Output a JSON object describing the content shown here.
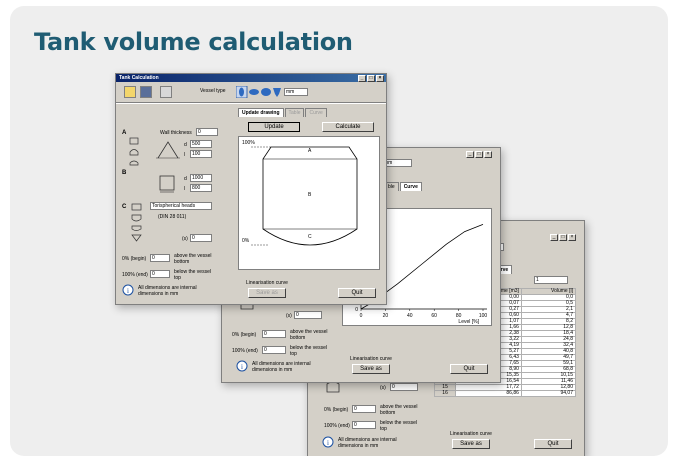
{
  "page_title": "Tank volume calculation",
  "colors": {
    "title": "#1f5c73",
    "card_bg": "#eeeeee",
    "titlebar": "#0a246a"
  },
  "win1": {
    "title": "Tank Calculation",
    "vessel_type_label": "Vessel type",
    "unit_select": "mm",
    "wall_thickness_label": "Wall thickness",
    "wall_thickness_value": "0",
    "section_a": "A",
    "section_b": "B",
    "section_c": "C",
    "a_d_label": "d",
    "a_d_value": "500",
    "a_l_label": "l",
    "a_l_value": "100",
    "b_d_label": "d",
    "b_d_value": "1000",
    "b_l_label": "l",
    "b_l_value": "800",
    "head_type": "Torispherical heads",
    "din_label": "(DIN 28 011)",
    "h_label": "(s)",
    "h_value": "0",
    "begin_label": "0% (begin)",
    "begin_value": "0",
    "begin_desc": "above the vessel bottom",
    "end_label": "100% (end)",
    "end_value": "0",
    "end_desc": "below the vessel top",
    "info_text": "All dimensions are internal dimensions in mm",
    "tabs": [
      "Update drawing",
      "Table",
      "Curve"
    ],
    "update_button": "Update",
    "calculate_button": "Calculate",
    "drawing_top_label": "100%",
    "drawing_bottom_label": "0%",
    "drawing_a": "A",
    "drawing_b": "B",
    "drawing_c": "C",
    "linearisation_label": "Linearisation curve",
    "save_button": "Save as",
    "quit_button": "Quit"
  },
  "win2": {
    "unit_select": "mm",
    "tabs": [
      "ble",
      "Curve"
    ],
    "h_label": "(s)",
    "h_value": "0",
    "begin_label": "0% (begin)",
    "begin_value": "0",
    "begin_desc": "above the vessel bottom",
    "end_label": "100% (end)",
    "end_value": "0",
    "end_desc": "below the vessel top",
    "info_text": "All dimensions are internal dimensions in mm",
    "linearisation_label": "Linearisation curve",
    "save_button": "Save as",
    "quit_button": "Quit",
    "x_axis_label": "Level [%]",
    "x_ticks": [
      "0",
      "20",
      "40",
      "60",
      "80",
      "100"
    ],
    "y_ticks": [
      "0",
      "50"
    ]
  },
  "win3": {
    "tab": "Curve",
    "select_value": "1",
    "col_headers": [
      "Volume [m3]",
      "Volume [l]"
    ],
    "rows": [
      {
        "idx": "",
        "v": "0,00",
        "l": "0,0"
      },
      {
        "idx": "",
        "v": "0,07",
        "l": "0,5"
      },
      {
        "idx": "",
        "v": "0,27",
        "l": "2,1"
      },
      {
        "idx": "",
        "v": "0,60",
        "l": "4,7"
      },
      {
        "idx": "",
        "v": "1,07",
        "l": "8,2"
      },
      {
        "idx": "",
        "v": "1,66",
        "l": "12,8"
      },
      {
        "idx": "",
        "v": "2,38",
        "l": "18,4"
      },
      {
        "idx": "",
        "v": "3,22",
        "l": "24,8"
      },
      {
        "idx": "",
        "v": "4,19",
        "l": "32,4"
      },
      {
        "idx": "",
        "v": "5,27",
        "l": "40,8"
      },
      {
        "idx": "",
        "v": "6,43",
        "l": "49,7"
      },
      {
        "idx": "",
        "v": "7,65",
        "l": "59,1"
      },
      {
        "idx": "",
        "v": "8,90",
        "l": "68,8"
      },
      {
        "idx": "13",
        "v": "15,35",
        "l": "10,15"
      },
      {
        "idx": "14",
        "v": "16,54",
        "l": "11,46"
      },
      {
        "idx": "15",
        "v": "17,72",
        "l": "12,80"
      },
      {
        "idx": "16",
        "v": "86,86",
        "l": "94,07"
      }
    ],
    "h_label": "(s)",
    "h_value": "0",
    "begin_label": "0% (begin)",
    "begin_value": "0",
    "begin_desc": "above the vessel bottom",
    "end_label": "100% (end)",
    "end_value": "0",
    "end_desc": "below the vessel top",
    "info_text": "All dimensions are internal dimensions in mm",
    "linearisation_label": "Linearisation curve",
    "save_button": "Save as",
    "quit_button": "Quit"
  },
  "chart_data": {
    "type": "line",
    "title": "",
    "xlabel": "Level [%]",
    "ylabel": "",
    "xlim": [
      0,
      100
    ],
    "ylim": [
      0,
      50
    ],
    "series": [
      {
        "x": [
          0,
          10,
          30,
          50,
          70,
          85,
          100
        ],
        "y": [
          0,
          4,
          14,
          25,
          36,
          43,
          47
        ]
      }
    ]
  }
}
